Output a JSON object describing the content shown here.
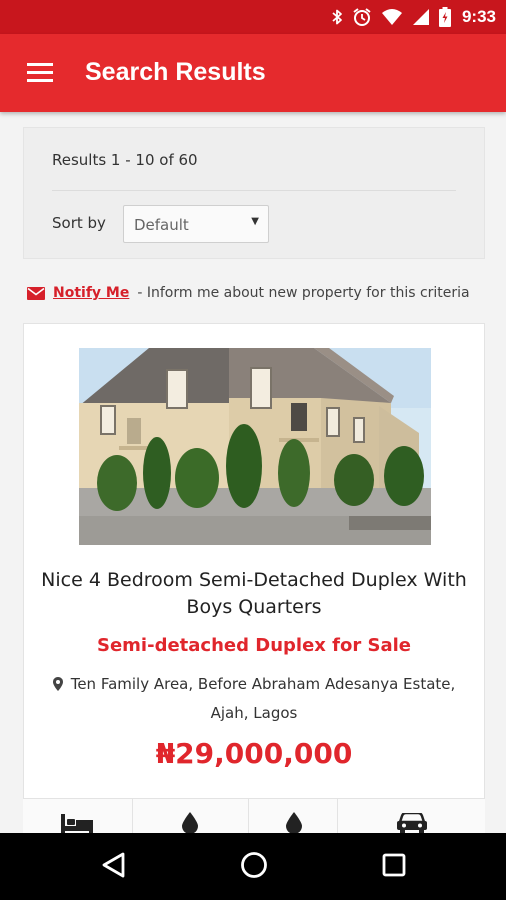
{
  "status_bar": {
    "time": "9:33",
    "icons": [
      "bluetooth-icon",
      "alarm-icon",
      "wifi-icon",
      "cell-signal-icon",
      "battery-charging-icon"
    ]
  },
  "header": {
    "title": "Search Results",
    "menu_icon": "hamburger-menu-icon"
  },
  "results": {
    "count_text": "Results 1 - 10 of 60",
    "sort_label": "Sort by",
    "sort_value": "Default"
  },
  "notify": {
    "link_text": "Notify Me",
    "description": "- Inform me about new property for this criteria",
    "icon": "envelope-icon"
  },
  "listing": {
    "title": "Nice 4 Bedroom Semi-Detached Duplex With Boys Quarters",
    "type": "Semi-detached Duplex for Sale",
    "location": "Ten Family Area, Before Abraham Adesanya Estate, Ajah, Lagos",
    "price": "₦29,000,000",
    "features": [
      "bed-icon",
      "water-drop-icon",
      "water-drop-icon",
      "car-icon"
    ]
  },
  "colors": {
    "status_bar": "#c8161d",
    "app_bar": "#e52a2d",
    "accent": "#e0262c"
  },
  "nav_bar": {
    "buttons": [
      "back-triangle-icon",
      "home-circle-icon",
      "recents-square-icon"
    ]
  }
}
